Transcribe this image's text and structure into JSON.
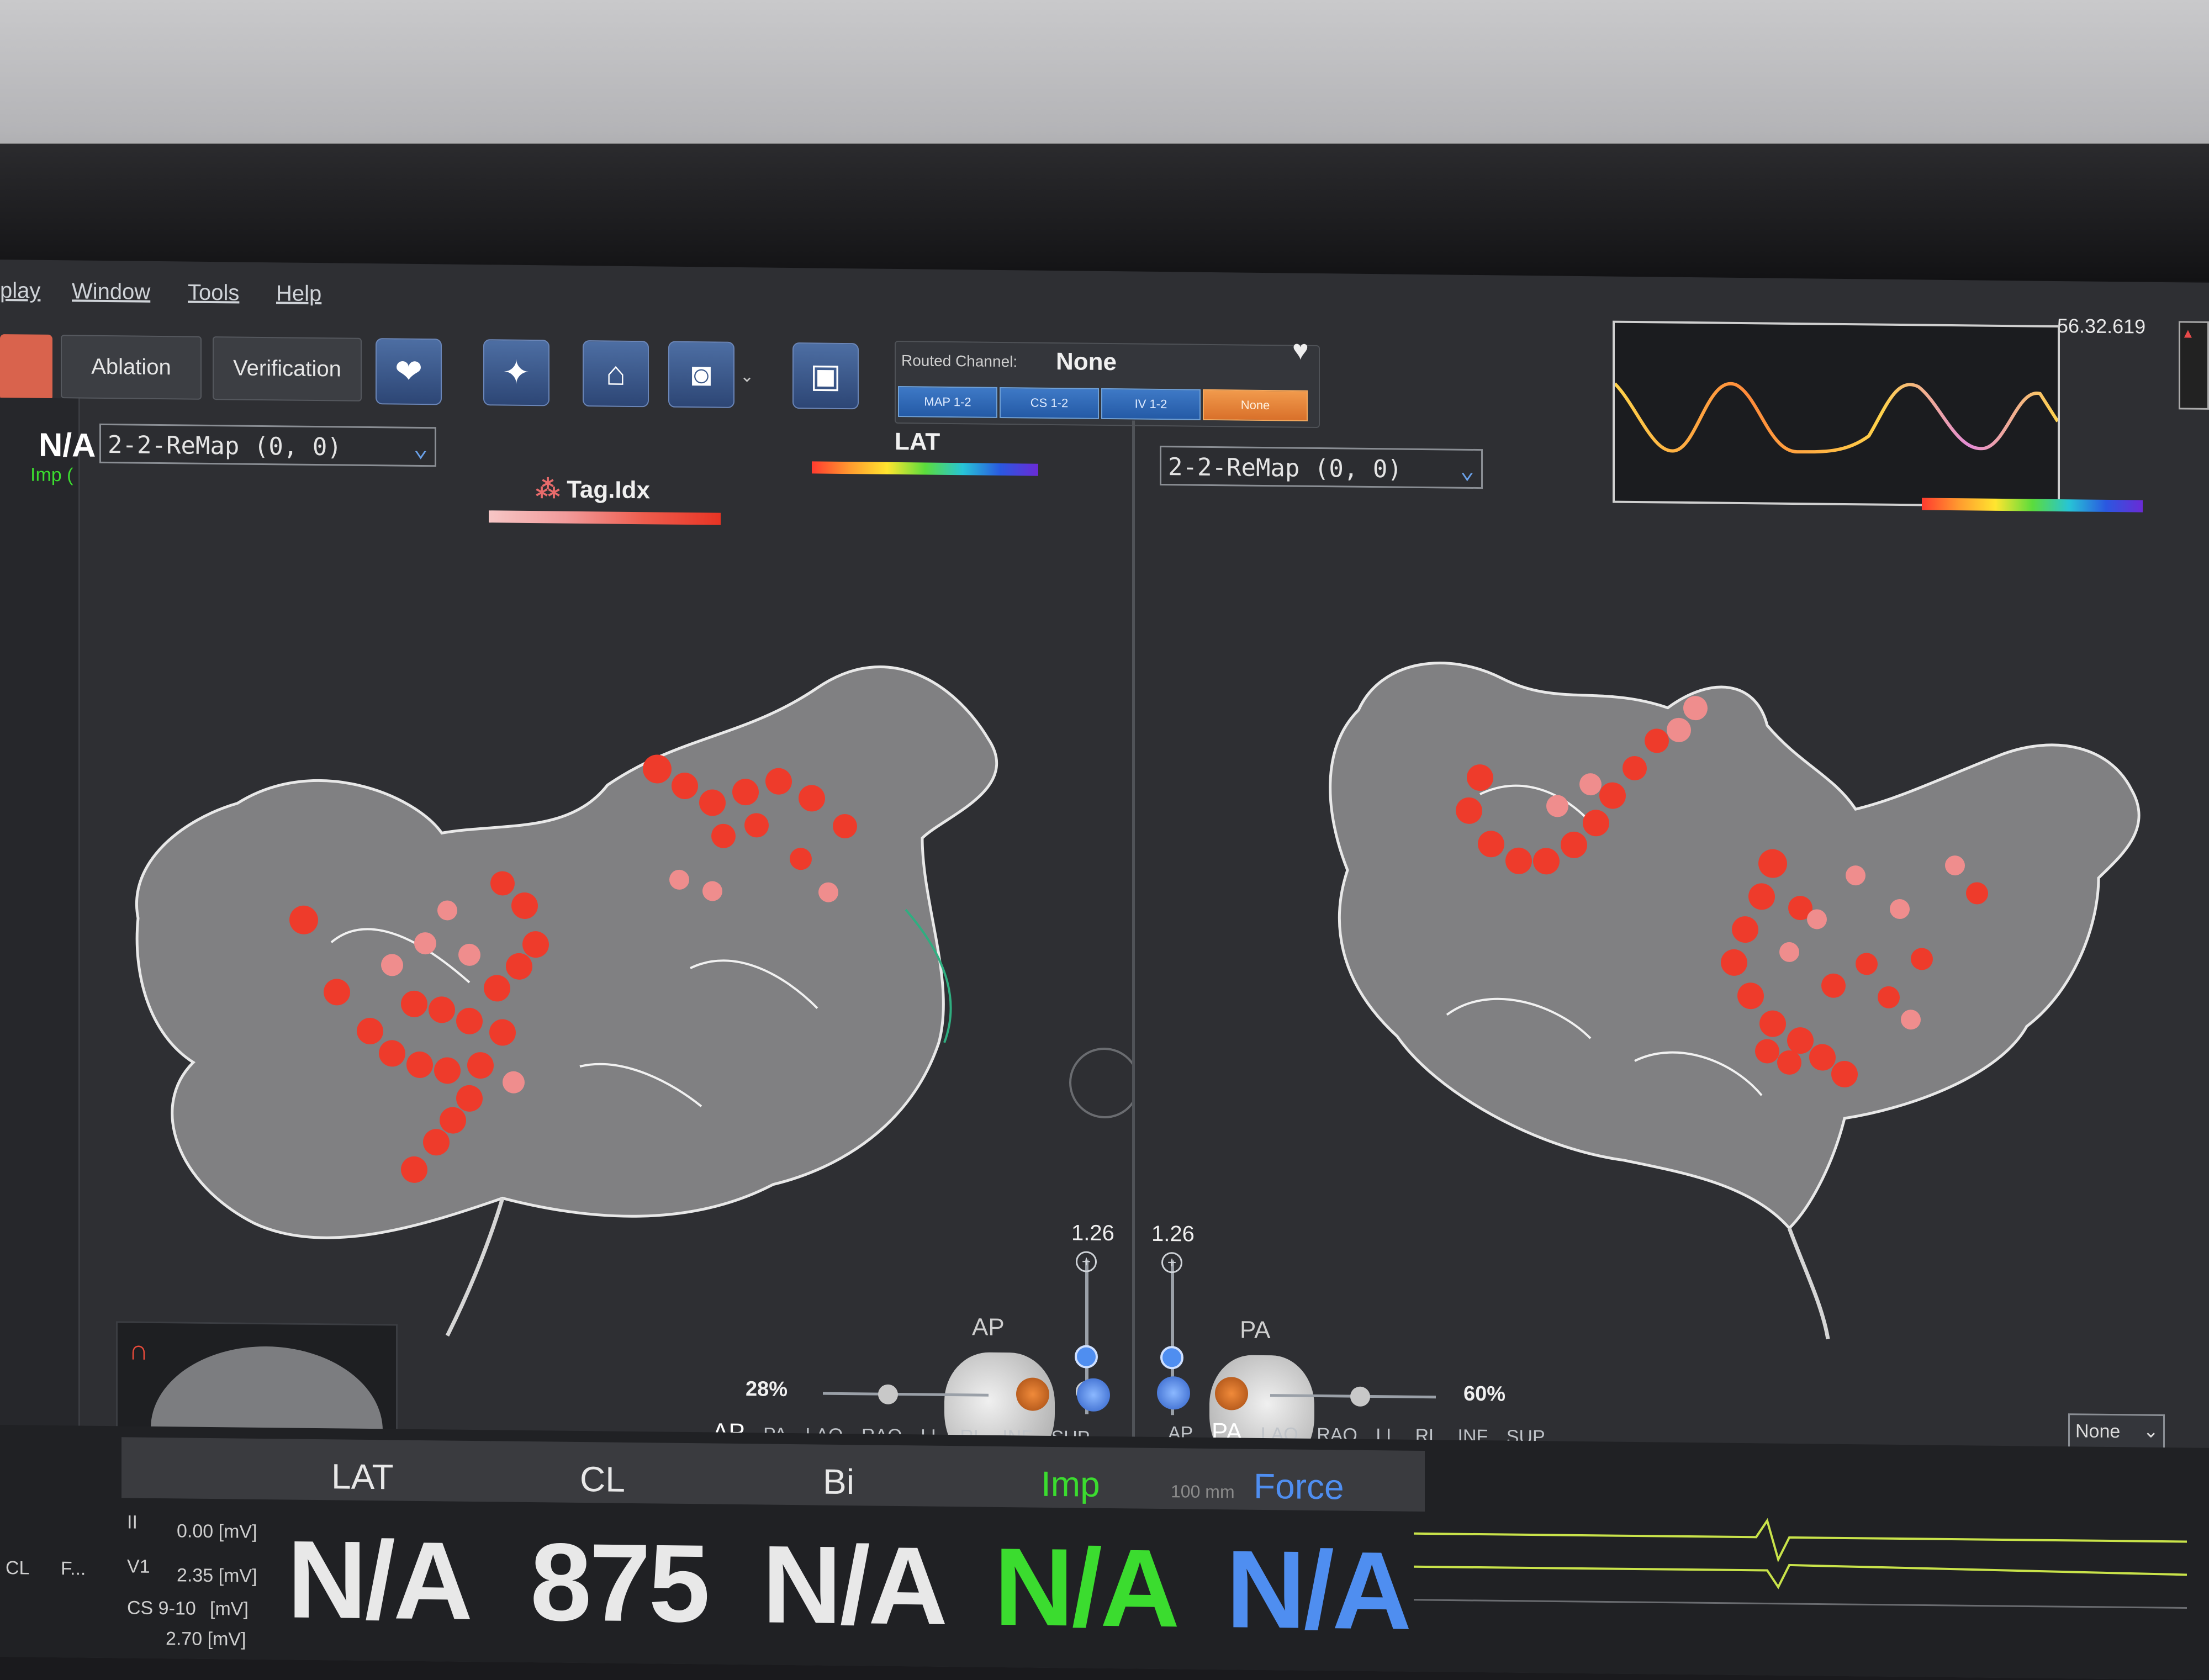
{
  "menu": {
    "items": [
      "play",
      "Window",
      "Tools",
      "Help"
    ]
  },
  "toolbar": {
    "ablation_label": "Ablation",
    "verification_label": "Verification",
    "routed_channel": {
      "label": "Routed Channel:",
      "value": "None",
      "channels": [
        "MAP 1-2",
        "CS 1-2",
        "IV 1-2",
        "None"
      ]
    }
  },
  "header": {
    "timestamp": "56.32.619"
  },
  "left_panel": {
    "map_select": "2-2-ReMap (0, 0)",
    "lat_label": "LAT",
    "tag_label": "Tag.Idx",
    "zoom_value": "1.26",
    "view_label": "AP",
    "opacity": "28%",
    "views": [
      "AP",
      "PA",
      "LAO",
      "RAO",
      "LL",
      "RL",
      "INF",
      "SUP"
    ],
    "active_view": "AP"
  },
  "right_panel": {
    "map_select": "2-2-ReMap (0, 0)",
    "zoom_value": "1.26",
    "view_label": "PA",
    "opacity": "60%",
    "views": [
      "AP",
      "PA",
      "LAO",
      "RAO",
      "LL",
      "RL",
      "INF",
      "SUP"
    ],
    "active_view": "PA",
    "none_select": "None"
  },
  "sidebar": {
    "na_label": "N/A",
    "imp_label": "Imp ("
  },
  "bottom": {
    "lat": {
      "label": "LAT",
      "value": "N/A"
    },
    "cl": {
      "label": "CL",
      "value": "875"
    },
    "bi": {
      "label": "Bi",
      "value": "N/A"
    },
    "imp": {
      "label": "Imp",
      "value": "N/A"
    },
    "force": {
      "label": "Force",
      "value": "N/A"
    },
    "scale_label": "100 mm",
    "ecg_labels": [
      "II",
      "V1",
      "CS 9-10"
    ],
    "ecg_values": [
      "0.00 [mV]",
      "2.35 [mV]",
      "[mV]",
      "2.70 [mV]"
    ],
    "side_labels": [
      "CL",
      "F..."
    ]
  },
  "colors": {
    "lat_value": "#e8e8e8",
    "imp_value": "#3bdc2f",
    "force_value": "#4f8ef0",
    "tag_dot": "#ee3b2b"
  }
}
